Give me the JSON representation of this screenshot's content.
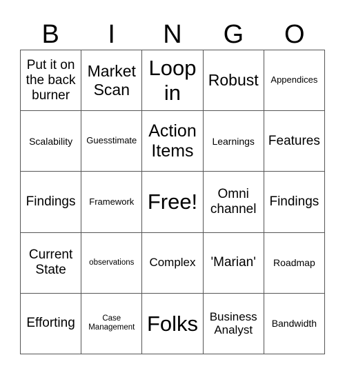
{
  "header": [
    "B",
    "I",
    "N",
    "G",
    "O"
  ],
  "cells": [
    [
      "Put it on the back burner",
      "Market Scan",
      "Loop in",
      "Robust",
      "Appendices"
    ],
    [
      "Scalability",
      "Guesstimate",
      "Action Items",
      "Learnings",
      "Features"
    ],
    [
      "Findings",
      "Framework",
      "Free!",
      "Omni channel",
      "Findings"
    ],
    [
      "Current State",
      "observations",
      "Complex",
      "'Marian'",
      "Roadmap"
    ],
    [
      "Efforting",
      "Case Management",
      "Folks",
      "Business Analyst",
      "Bandwidth"
    ]
  ]
}
